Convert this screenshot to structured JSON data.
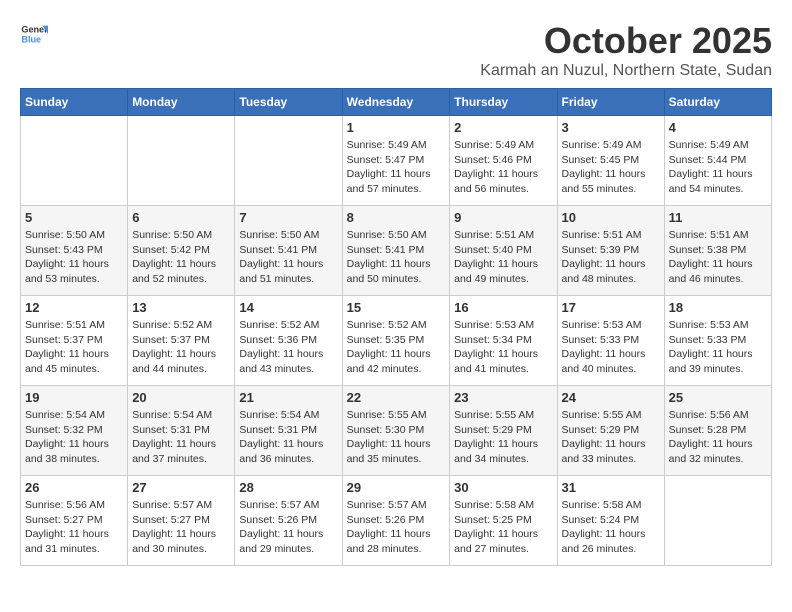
{
  "header": {
    "logo_general": "General",
    "logo_blue": "Blue",
    "month_title": "October 2025",
    "location": "Karmah an Nuzul, Northern State, Sudan"
  },
  "days_of_week": [
    "Sunday",
    "Monday",
    "Tuesday",
    "Wednesday",
    "Thursday",
    "Friday",
    "Saturday"
  ],
  "weeks": [
    [
      {
        "day": "",
        "info": ""
      },
      {
        "day": "",
        "info": ""
      },
      {
        "day": "",
        "info": ""
      },
      {
        "day": "1",
        "info": "Sunrise: 5:49 AM\nSunset: 5:47 PM\nDaylight: 11 hours\nand 57 minutes."
      },
      {
        "day": "2",
        "info": "Sunrise: 5:49 AM\nSunset: 5:46 PM\nDaylight: 11 hours\nand 56 minutes."
      },
      {
        "day": "3",
        "info": "Sunrise: 5:49 AM\nSunset: 5:45 PM\nDaylight: 11 hours\nand 55 minutes."
      },
      {
        "day": "4",
        "info": "Sunrise: 5:49 AM\nSunset: 5:44 PM\nDaylight: 11 hours\nand 54 minutes."
      }
    ],
    [
      {
        "day": "5",
        "info": "Sunrise: 5:50 AM\nSunset: 5:43 PM\nDaylight: 11 hours\nand 53 minutes."
      },
      {
        "day": "6",
        "info": "Sunrise: 5:50 AM\nSunset: 5:42 PM\nDaylight: 11 hours\nand 52 minutes."
      },
      {
        "day": "7",
        "info": "Sunrise: 5:50 AM\nSunset: 5:41 PM\nDaylight: 11 hours\nand 51 minutes."
      },
      {
        "day": "8",
        "info": "Sunrise: 5:50 AM\nSunset: 5:41 PM\nDaylight: 11 hours\nand 50 minutes."
      },
      {
        "day": "9",
        "info": "Sunrise: 5:51 AM\nSunset: 5:40 PM\nDaylight: 11 hours\nand 49 minutes."
      },
      {
        "day": "10",
        "info": "Sunrise: 5:51 AM\nSunset: 5:39 PM\nDaylight: 11 hours\nand 48 minutes."
      },
      {
        "day": "11",
        "info": "Sunrise: 5:51 AM\nSunset: 5:38 PM\nDaylight: 11 hours\nand 46 minutes."
      }
    ],
    [
      {
        "day": "12",
        "info": "Sunrise: 5:51 AM\nSunset: 5:37 PM\nDaylight: 11 hours\nand 45 minutes."
      },
      {
        "day": "13",
        "info": "Sunrise: 5:52 AM\nSunset: 5:37 PM\nDaylight: 11 hours\nand 44 minutes."
      },
      {
        "day": "14",
        "info": "Sunrise: 5:52 AM\nSunset: 5:36 PM\nDaylight: 11 hours\nand 43 minutes."
      },
      {
        "day": "15",
        "info": "Sunrise: 5:52 AM\nSunset: 5:35 PM\nDaylight: 11 hours\nand 42 minutes."
      },
      {
        "day": "16",
        "info": "Sunrise: 5:53 AM\nSunset: 5:34 PM\nDaylight: 11 hours\nand 41 minutes."
      },
      {
        "day": "17",
        "info": "Sunrise: 5:53 AM\nSunset: 5:33 PM\nDaylight: 11 hours\nand 40 minutes."
      },
      {
        "day": "18",
        "info": "Sunrise: 5:53 AM\nSunset: 5:33 PM\nDaylight: 11 hours\nand 39 minutes."
      }
    ],
    [
      {
        "day": "19",
        "info": "Sunrise: 5:54 AM\nSunset: 5:32 PM\nDaylight: 11 hours\nand 38 minutes."
      },
      {
        "day": "20",
        "info": "Sunrise: 5:54 AM\nSunset: 5:31 PM\nDaylight: 11 hours\nand 37 minutes."
      },
      {
        "day": "21",
        "info": "Sunrise: 5:54 AM\nSunset: 5:31 PM\nDaylight: 11 hours\nand 36 minutes."
      },
      {
        "day": "22",
        "info": "Sunrise: 5:55 AM\nSunset: 5:30 PM\nDaylight: 11 hours\nand 35 minutes."
      },
      {
        "day": "23",
        "info": "Sunrise: 5:55 AM\nSunset: 5:29 PM\nDaylight: 11 hours\nand 34 minutes."
      },
      {
        "day": "24",
        "info": "Sunrise: 5:55 AM\nSunset: 5:29 PM\nDaylight: 11 hours\nand 33 minutes."
      },
      {
        "day": "25",
        "info": "Sunrise: 5:56 AM\nSunset: 5:28 PM\nDaylight: 11 hours\nand 32 minutes."
      }
    ],
    [
      {
        "day": "26",
        "info": "Sunrise: 5:56 AM\nSunset: 5:27 PM\nDaylight: 11 hours\nand 31 minutes."
      },
      {
        "day": "27",
        "info": "Sunrise: 5:57 AM\nSunset: 5:27 PM\nDaylight: 11 hours\nand 30 minutes."
      },
      {
        "day": "28",
        "info": "Sunrise: 5:57 AM\nSunset: 5:26 PM\nDaylight: 11 hours\nand 29 minutes."
      },
      {
        "day": "29",
        "info": "Sunrise: 5:57 AM\nSunset: 5:26 PM\nDaylight: 11 hours\nand 28 minutes."
      },
      {
        "day": "30",
        "info": "Sunrise: 5:58 AM\nSunset: 5:25 PM\nDaylight: 11 hours\nand 27 minutes."
      },
      {
        "day": "31",
        "info": "Sunrise: 5:58 AM\nSunset: 5:24 PM\nDaylight: 11 hours\nand 26 minutes."
      },
      {
        "day": "",
        "info": ""
      }
    ]
  ]
}
